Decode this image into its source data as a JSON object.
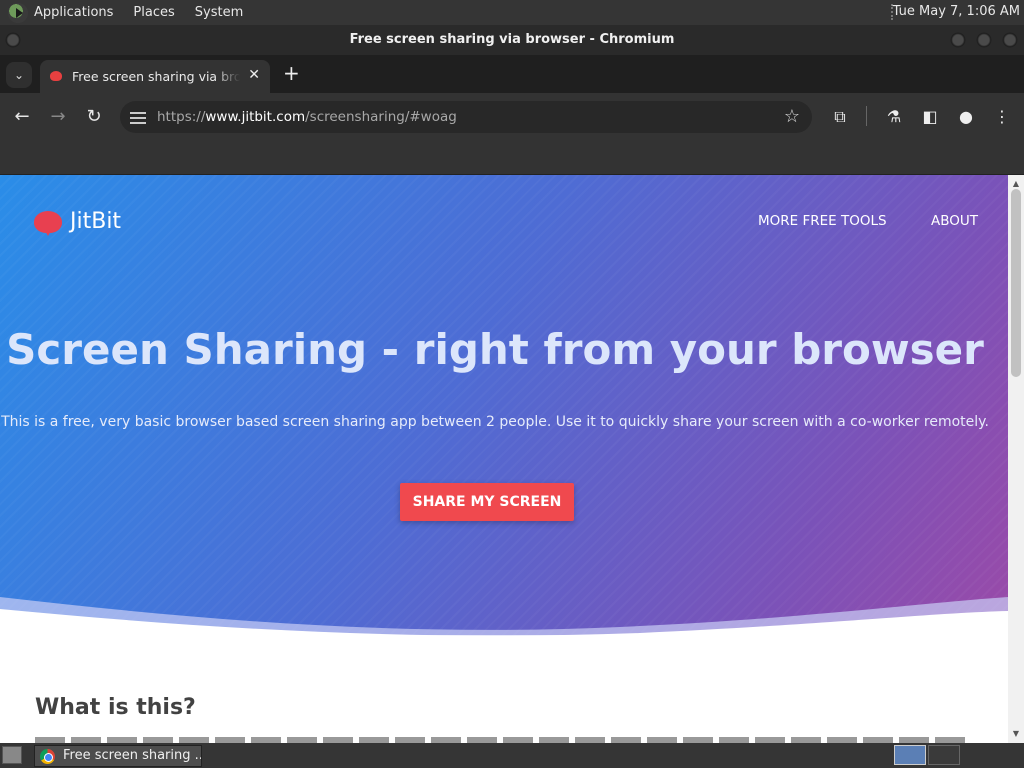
{
  "topbar": {
    "menus": [
      "Applications",
      "Places",
      "System"
    ],
    "clock": "Tue May  7,  1:06 AM"
  },
  "window": {
    "title": "Free screen sharing via browser - Chromium"
  },
  "tabs": [
    {
      "title": "Free screen sharing via browser",
      "active": true
    }
  ],
  "omnibox": {
    "scheme": "https://",
    "domain": "www.jitbit.com",
    "path": "/screensharing/#woag"
  },
  "page": {
    "logo": "JitBit",
    "nav": [
      "MORE FREE TOOLS",
      "ABOUT"
    ],
    "headline": "Screen Sharing - right from your browser",
    "subtitle": "This is a free, very basic browser based screen sharing app between 2 people. Use it to quickly share your screen with a co-worker remotely.",
    "cta": "SHARE MY SCREEN",
    "section_title": "What is this?"
  },
  "taskbar": {
    "task_label": "Free screen sharing ..."
  },
  "colors": {
    "hero_start": "#2a8de8",
    "hero_end": "#9a4aa8",
    "cta": "#f0494e",
    "logo_red": "#e84050"
  }
}
